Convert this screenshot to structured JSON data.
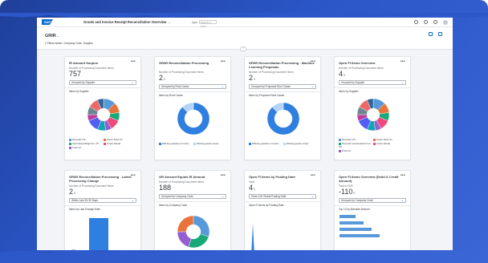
{
  "shell": {
    "logo": "SAP",
    "app_title": "Goods and Invoice Receipt Reconciliation Overview",
    "tag": "Apps",
    "search_placeholder": "Search in: Apps"
  },
  "header": {
    "page_title": "GRIR",
    "filter_text": "2 Filters active: Company Code, Supplier"
  },
  "cards": [
    {
      "title": "IR Amount Surplus",
      "subtitle": "Number of Processing Document Items",
      "kpi": "757",
      "kpi_unit": "",
      "select": "Grouped by Supplier",
      "chart_title": "Items by Supplier",
      "legend": [
        "Domestic US...",
        "Power Parts Inc.",
        "International Bright Ac. US",
        "Crown Rental",
        "Tools Inc."
      ]
    },
    {
      "title": "GR/IR Reconciliation Processing",
      "subtitle": "Number of Processing Document Items",
      "kpi": "2",
      "kpi_unit": "K",
      "select": "Grouped by Root Cause",
      "chart_title": "Items by Root Cause",
      "legend": [
        "Differing quantity in invoice",
        "Missing goods receipt"
      ]
    },
    {
      "title": "GR/IR Reconciliation Processing - Machine Learning Proposals",
      "subtitle": "Number of Processing Document Items",
      "kpi": "2",
      "kpi_unit": "K",
      "select": "Grouped by Proposed Root Cause",
      "chart_title": "Items by Proposed Root Cause",
      "legend": [
        "Differing quantity in invoice",
        "Missing goods receipt"
      ]
    },
    {
      "title": "Open FI Items Overview",
      "subtitle": "Number of Processing Document Items",
      "kpi": "4",
      "kpi_unit": "K",
      "select": "Grouped by Supplier",
      "chart_title": "Items by Supplier",
      "legend": [
        "Domestic US...",
        "Power Parts Inc.",
        "Domestic semiconductor Ind. US",
        "Crown Rental",
        "Tools Inc."
      ]
    },
    {
      "title": "GR/IR Reconciliation Processing - Latest Processing Change",
      "subtitle": "Number of Processing Document Items",
      "kpi": "2",
      "kpi_unit": "K",
      "select": "Within Last 25-90 Days",
      "chart_title": "Items by Last Change Date"
    },
    {
      "title": "GR Amount Equals IR Amount",
      "subtitle": "Number of Processing Document Items",
      "kpi": "188",
      "kpi_unit": "",
      "select": "Grouped by Company Code",
      "chart_title": "Items by Company Code"
    },
    {
      "title": "Open FI Items by Posting Date",
      "subtitle": "Total",
      "kpi": "4",
      "kpi_unit": "K",
      "select": "Since 100 Global Posting Date",
      "chart_title": "Open FI Items by Posting Date"
    },
    {
      "title": "Open FI Items Overview (Debit & Credit Amount)",
      "subtitle": "Total in EUR",
      "kpi": "-110",
      "kpi_unit": "K",
      "select": "Grouped by Company Code",
      "chart_title": "Top 10 by Absolute Amount"
    }
  ],
  "colors": {
    "accent": "#0a6ed1",
    "pie": [
      "#5899da",
      "#e8743b",
      "#19a979",
      "#ed4a7b",
      "#945ecf",
      "#13a4b4",
      "#525df4",
      "#bf399e",
      "#6c8893",
      "#ee6868",
      "#2f6497"
    ]
  },
  "icons": [
    "sap-logo",
    "search-icon",
    "gear-icon",
    "bell-icon",
    "avatar",
    "share-icon",
    "collapse-icon",
    "more-icon"
  ]
}
